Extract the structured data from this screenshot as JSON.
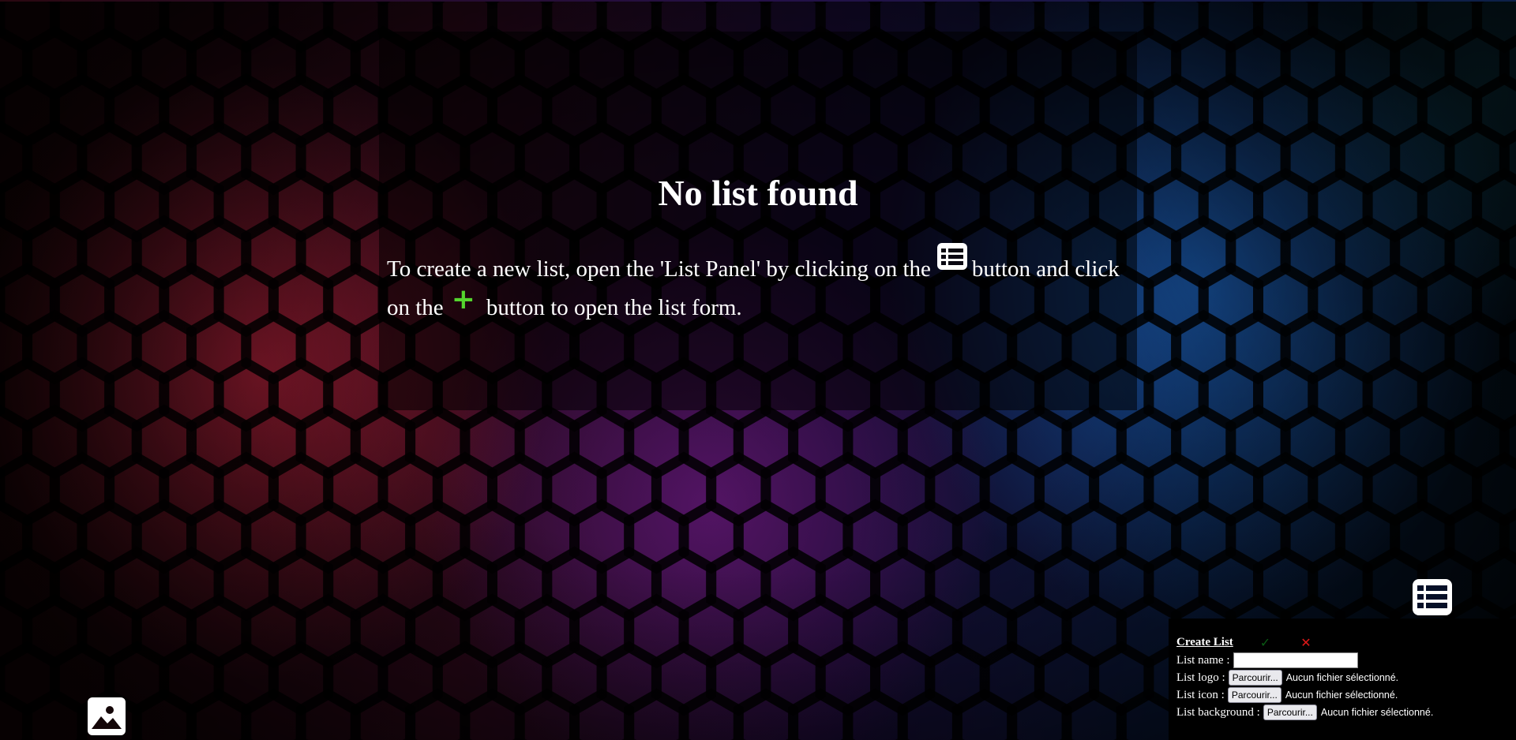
{
  "main": {
    "title": "No list found",
    "instruction_part1": "To create a new list, open the 'List Panel' by clicking on the",
    "instruction_part2": "button and click on the",
    "instruction_part3": "button to open the list form."
  },
  "icons": {
    "list_panel": "list-icon",
    "add": "plus-icon",
    "image": "image-icon"
  },
  "colors": {
    "add_icon": "#55d62e",
    "confirm": "#0a5a14",
    "cancel": "#e01818"
  },
  "create_list_form": {
    "title": "Create List",
    "confirm_symbol": "✓",
    "cancel_symbol": "✕",
    "name_label": "List name :",
    "name_value": "",
    "logo_label": "List logo :",
    "icon_label": "List icon :",
    "background_label": "List background :",
    "browse_label": "Parcourir...",
    "no_file_text": "Aucun fichier sélectionné."
  }
}
